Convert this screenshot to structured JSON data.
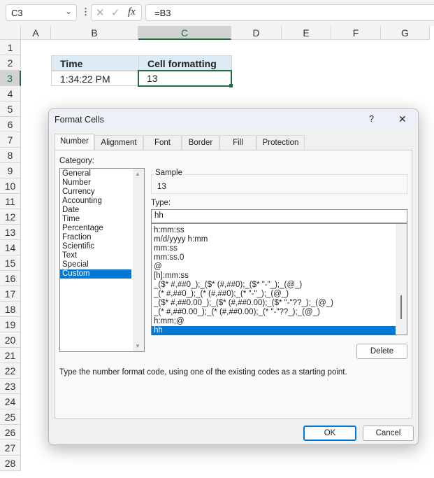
{
  "formula_bar": {
    "name_box": "C3",
    "formula": "=B3",
    "cancel_icon": "✕",
    "enter_icon": "✓",
    "fx_icon": "fx"
  },
  "columns": [
    "A",
    "B",
    "C",
    "D",
    "E",
    "F",
    "G"
  ],
  "rows": [
    "1",
    "2",
    "3",
    "4",
    "5",
    "6",
    "7",
    "8",
    "9",
    "10",
    "11",
    "12",
    "13",
    "14",
    "15",
    "16",
    "17",
    "18",
    "19",
    "20",
    "21",
    "22",
    "23",
    "24",
    "25",
    "26",
    "27",
    "28"
  ],
  "cells": {
    "B2": "Time",
    "C2": "Cell formatting",
    "B3": "1:34:22 PM",
    "C3": "13"
  },
  "dialog": {
    "title": "Format Cells",
    "help": "?",
    "close": "✕",
    "tabs": [
      "Number",
      "Alignment",
      "Font",
      "Border",
      "Fill",
      "Protection"
    ],
    "active_tab": "Number",
    "category_label": "Category:",
    "categories": [
      "General",
      "Number",
      "Currency",
      "Accounting",
      "Date",
      "Time",
      "Percentage",
      "Fraction",
      "Scientific",
      "Text",
      "Special",
      "Custom"
    ],
    "selected_category": "Custom",
    "sample_label": "Sample",
    "sample_value": "13",
    "type_label": "Type:",
    "type_value": "hh",
    "type_list": [
      "h:mm:ss",
      "m/d/yyyy h:mm",
      "mm:ss",
      "mm:ss.0",
      "@",
      "[h]:mm:ss",
      "_($* #,##0_);_($* (#,##0);_($* \"-\"_);_(@_)",
      "_(* #,##0_);_(* (#,##0);_(* \"-\"_);_(@_)",
      "_($* #,##0.00_);_($* (#,##0.00);_($* \"-\"??_);_(@_)",
      "_(* #,##0.00_);_(* (#,##0.00);_(* \"-\"??_);_(@_)",
      "h:mm;@",
      "hh"
    ],
    "selected_type": "hh",
    "delete": "Delete",
    "description": "Type the number format code, using one of the existing codes as a starting point.",
    "ok": "OK",
    "cancel": "Cancel"
  },
  "colors": {
    "accent": "#0078d7",
    "excel_green": "#1e6e3e",
    "header_fill": "#ddebf7"
  }
}
